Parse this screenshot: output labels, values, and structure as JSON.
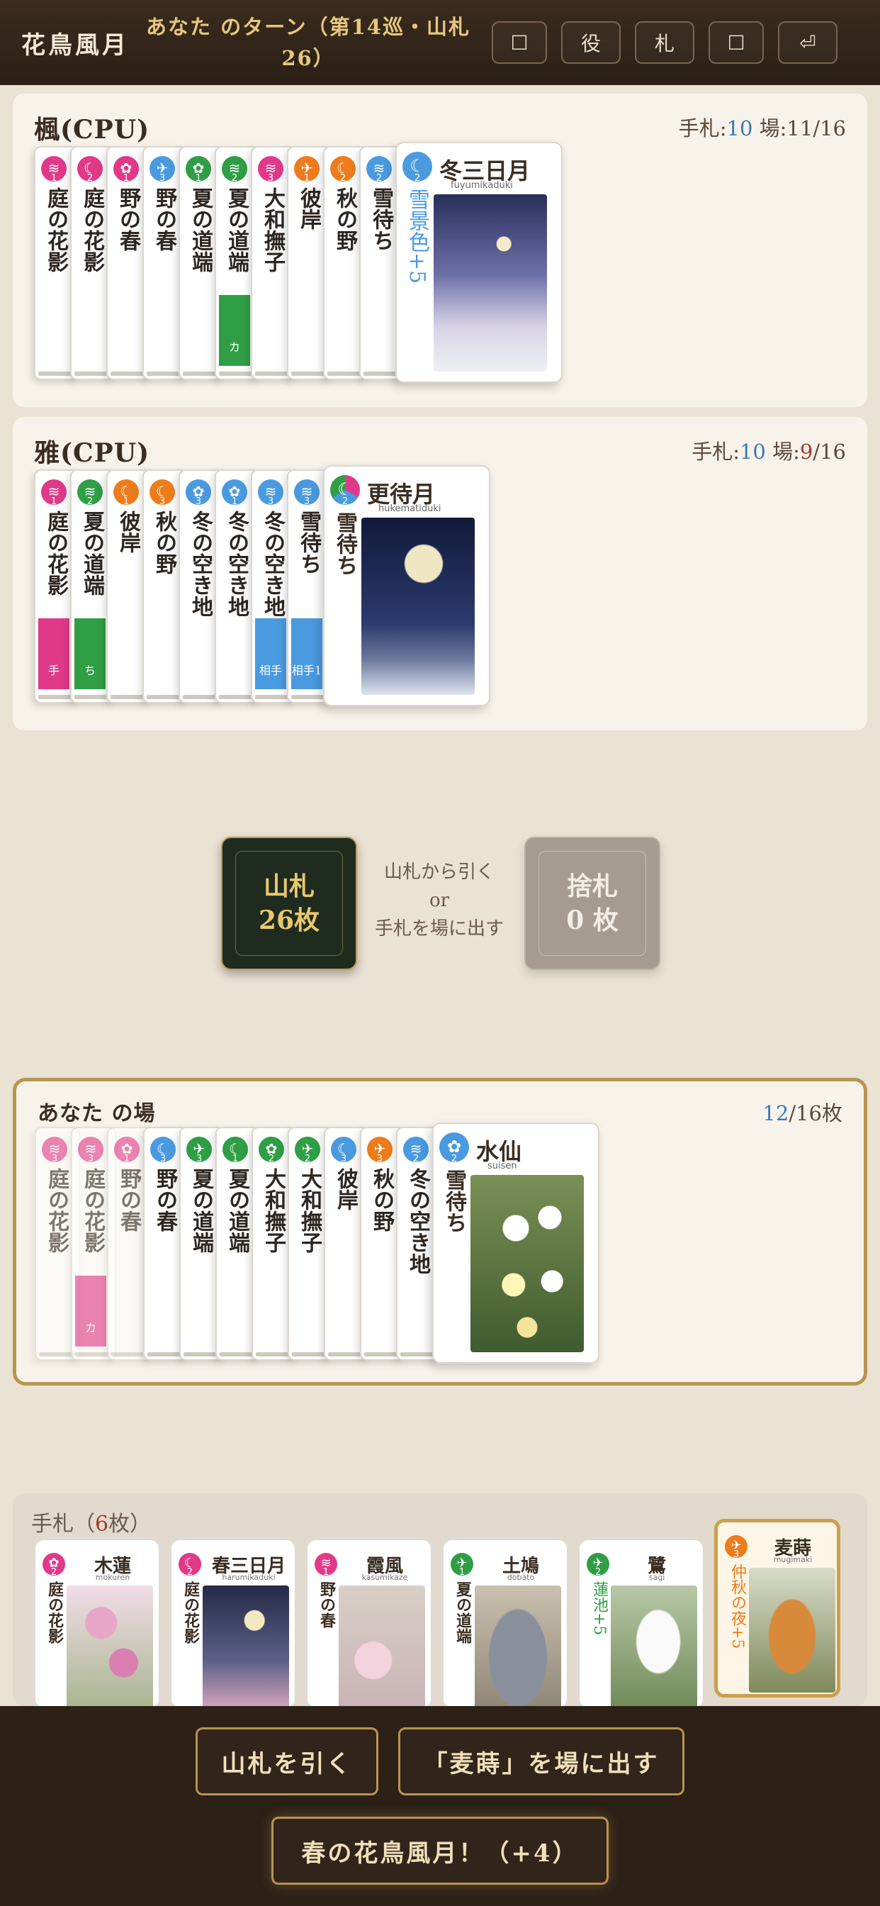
{
  "header": {
    "logo": "花鳥風月",
    "turn": "あなた のターン（第14巡・山札26）",
    "buttons": [
      "☐",
      "役",
      "札",
      "☐",
      "⏎"
    ]
  },
  "cpu1": {
    "name": "楓(CPU)",
    "hand_label": "手札:",
    "hand_count": "10",
    "field_label": "場:",
    "field_value": "11/16",
    "cards": [
      {
        "label": "庭の花影",
        "color": "pink",
        "mark": "≋",
        "num": "1"
      },
      {
        "label": "庭の花影",
        "color": "pink",
        "mark": "☾",
        "num": "2"
      },
      {
        "label": "野の春",
        "color": "pink",
        "mark": "✿",
        "num": "1"
      },
      {
        "label": "野の春",
        "color": "blue",
        "mark": "✈",
        "num": "3"
      },
      {
        "label": "夏の道端",
        "color": "green",
        "mark": "✿",
        "num": "1"
      },
      {
        "label": "夏の道端",
        "color": "green",
        "mark": "≋",
        "num": "2",
        "stripe": "green",
        "stripe_text": "カ"
      },
      {
        "label": "大和撫子",
        "color": "pink",
        "mark": "≋",
        "num": "3"
      },
      {
        "label": "彼岸",
        "color": "orange",
        "mark": "✈",
        "num": "1"
      },
      {
        "label": "秋の野",
        "color": "orange",
        "mark": "☾",
        "num": "2"
      },
      {
        "label": "雪待ち",
        "color": "blue",
        "mark": "≋",
        "num": "2"
      }
    ],
    "top": {
      "title": "冬三日月",
      "roma": "fuyumikaduki",
      "sub": "雪景色+5",
      "color": "blue",
      "mark": "☾",
      "num": "2"
    }
  },
  "cpu2": {
    "name": "雅(CPU)",
    "hand_label": "手札:",
    "hand_count": "10",
    "field_label": "場:",
    "field_num": "9",
    "field_total": "/16",
    "cards": [
      {
        "label": "庭の花影",
        "color": "pink",
        "mark": "≋",
        "num": "1",
        "stripe": "pink",
        "stripe_text": "手"
      },
      {
        "label": "夏の道端",
        "color": "green",
        "mark": "≋",
        "num": "2",
        "stripe": "green",
        "stripe_text": "ち"
      },
      {
        "label": "彼岸",
        "color": "orange",
        "mark": "☾",
        "num": "1"
      },
      {
        "label": "秋の野",
        "color": "orange",
        "mark": "☾",
        "num": "3"
      },
      {
        "label": "冬の空き地",
        "color": "blue",
        "mark": "✿",
        "num": "3"
      },
      {
        "label": "冬の空き地",
        "color": "blue",
        "mark": "✿",
        "num": "1"
      },
      {
        "label": "冬の空き地",
        "color": "blue",
        "mark": "≋",
        "num": "3",
        "stripe": "blue",
        "stripe_text": "相手"
      },
      {
        "label": "雪待ち",
        "color": "blue",
        "mark": "≋",
        "num": "3",
        "stripe": "blue",
        "stripe_text": "相手1"
      }
    ],
    "top": {
      "title": "更待月",
      "roma": "hukematiduki",
      "sub": "雪待ち",
      "color": "mix",
      "mark": "☾",
      "num": "2"
    }
  },
  "deck": {
    "line1": "山札",
    "line2": "26枚"
  },
  "hint": [
    "山札から引く",
    "or",
    "手札を場に出す"
  ],
  "discard": {
    "line1": "捨札",
    "line2": "0 枚"
  },
  "field": {
    "name": "あなた の場",
    "count": "12",
    "total": "/16枚",
    "cards": [
      {
        "label": "庭の花影",
        "color": "pink",
        "mark": "≋",
        "num": "3",
        "fade": true
      },
      {
        "label": "庭の花影",
        "color": "pink",
        "mark": "≋",
        "num": "3",
        "fade": true,
        "stripe": "pink",
        "stripe_text": "カ"
      },
      {
        "label": "野の春",
        "color": "pink",
        "mark": "✿",
        "num": "1",
        "fade": true
      },
      {
        "label": "野の春",
        "color": "blue",
        "mark": "☾",
        "num": "3"
      },
      {
        "label": "夏の道端",
        "color": "green",
        "mark": "✈",
        "num": "3"
      },
      {
        "label": "夏の道端",
        "color": "green",
        "mark": "☾",
        "num": "1"
      },
      {
        "label": "大和撫子",
        "color": "green",
        "mark": "✿",
        "num": "2"
      },
      {
        "label": "大和撫子",
        "color": "green",
        "mark": "✈",
        "num": "2"
      },
      {
        "label": "彼岸",
        "color": "blue",
        "mark": "☾",
        "num": "3"
      },
      {
        "label": "秋の野",
        "color": "orange",
        "mark": "✈",
        "num": "3"
      },
      {
        "label": "冬の空き地",
        "color": "blue",
        "mark": "≋",
        "num": "2"
      }
    ],
    "top": {
      "title": "水仙",
      "roma": "suisen",
      "sub": "雪待ち",
      "color": "blue",
      "mark": "✿",
      "num": "2"
    }
  },
  "hand": {
    "label": "手札（",
    "count": "6",
    "unit": "枚）",
    "cards": [
      {
        "title": "木蓮",
        "roma": "mokuren",
        "sub": "庭の花影",
        "color": "pink",
        "mark": "✿",
        "num": "2"
      },
      {
        "title": "春三日月",
        "roma": "harumikaduki",
        "sub": "庭の花影",
        "color": "pink",
        "mark": "☾",
        "num": "2"
      },
      {
        "title": "霞風",
        "roma": "kasumikaze",
        "sub": "野の春",
        "color": "pink",
        "mark": "≋",
        "num": "1"
      },
      {
        "title": "土鳩",
        "roma": "dobato",
        "sub": "夏の道端",
        "color": "green",
        "mark": "✈",
        "num": "1"
      },
      {
        "title": "鷺",
        "roma": "sagi",
        "sub": "蓮池+5",
        "color": "green",
        "mark": "✈",
        "num": "2"
      },
      {
        "title": "麦蒔",
        "roma": "mugimaki",
        "sub": "仲秋の夜+5",
        "color": "orange",
        "mark": "✈",
        "num": "3",
        "selected": true
      }
    ]
  },
  "actions": {
    "draw": "山札を引く",
    "play": "「麦蒔」を場に出す",
    "combo": "春の花鳥風月！（+4）"
  },
  "colors": {
    "pink": "#e1398a",
    "green": "#2f9e45",
    "orange": "#ee7c1c",
    "blue": "#4a9ae0",
    "gold": "#b89550",
    "header": "#2b2016"
  }
}
